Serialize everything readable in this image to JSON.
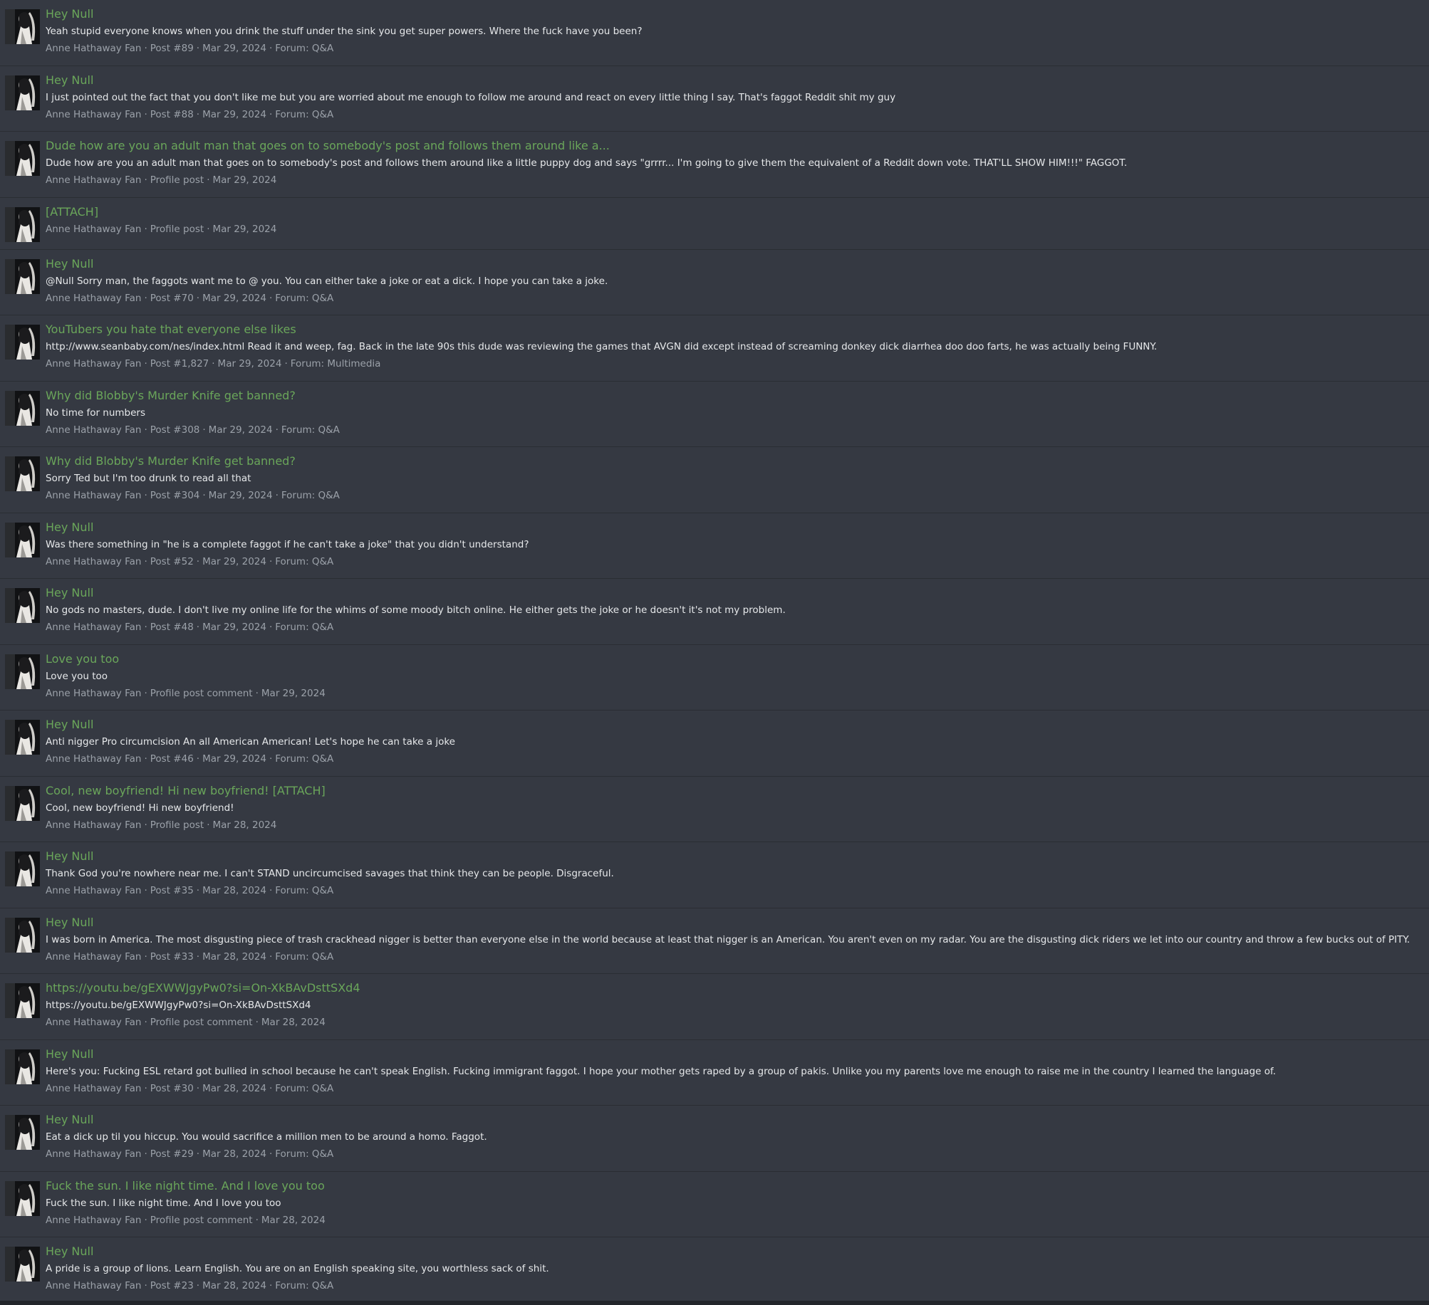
{
  "separator": "·",
  "results": [
    {
      "title": "Hey Null",
      "snippet": "Yeah stupid everyone knows when you drink the stuff under the sink you get super powers. Where the fuck have you been?",
      "user": "Anne Hathaway Fan",
      "type": "Post #89",
      "date": "Mar 29, 2024",
      "forum": "Forum: Q&A"
    },
    {
      "title": "Hey Null",
      "snippet": "I just pointed out the fact that you don't like me but you are worried about me enough to follow me around and react on every little thing I say. That's faggot Reddit shit my guy",
      "user": "Anne Hathaway Fan",
      "type": "Post #88",
      "date": "Mar 29, 2024",
      "forum": "Forum: Q&A"
    },
    {
      "title": "Dude how are you an adult man that goes on to somebody's post and follows them around like a...",
      "snippet": "Dude how are you an adult man that goes on to somebody's post and follows them around like a little puppy dog and says \"grrrr... I'm going to give them the equivalent of a Reddit down vote. THAT'LL SHOW HIM!!!\" FAGGOT.",
      "user": "Anne Hathaway Fan",
      "type": "Profile post",
      "date": "Mar 29, 2024",
      "forum": ""
    },
    {
      "title": "[ATTACH]",
      "snippet": "",
      "user": "Anne Hathaway Fan",
      "type": "Profile post",
      "date": "Mar 29, 2024",
      "forum": ""
    },
    {
      "title": "Hey Null",
      "snippet": "@Null Sorry man, the faggots want me to @ you. You can either take a joke or eat a dick. I hope you can take a joke.",
      "user": "Anne Hathaway Fan",
      "type": "Post #70",
      "date": "Mar 29, 2024",
      "forum": "Forum: Q&A"
    },
    {
      "title": "YouTubers you hate that everyone else likes",
      "snippet": "http://www.seanbaby.com/nes/index.html Read it and weep, fag. Back in the late 90s this dude was reviewing the games that AVGN did except instead of screaming donkey dick diarrhea doo doo farts, he was actually being FUNNY.",
      "user": "Anne Hathaway Fan",
      "type": "Post #1,827",
      "date": "Mar 29, 2024",
      "forum": "Forum: Multimedia"
    },
    {
      "title": "Why did Blobby's Murder Knife get banned?",
      "snippet": "No time for numbers",
      "user": "Anne Hathaway Fan",
      "type": "Post #308",
      "date": "Mar 29, 2024",
      "forum": "Forum: Q&A"
    },
    {
      "title": "Why did Blobby's Murder Knife get banned?",
      "snippet": "Sorry Ted but I'm too drunk to read all that",
      "user": "Anne Hathaway Fan",
      "type": "Post #304",
      "date": "Mar 29, 2024",
      "forum": "Forum: Q&A"
    },
    {
      "title": "Hey Null",
      "snippet": "Was there something in \"he is a complete faggot if he can't take a joke\" that you didn't understand?",
      "user": "Anne Hathaway Fan",
      "type": "Post #52",
      "date": "Mar 29, 2024",
      "forum": "Forum: Q&A"
    },
    {
      "title": "Hey Null",
      "snippet": "No gods no masters, dude. I don't live my online life for the whims of some moody bitch online. He either gets the joke or he doesn't it's not my problem.",
      "user": "Anne Hathaway Fan",
      "type": "Post #48",
      "date": "Mar 29, 2024",
      "forum": "Forum: Q&A"
    },
    {
      "title": "Love you too",
      "snippet": "Love you too",
      "user": "Anne Hathaway Fan",
      "type": "Profile post comment",
      "date": "Mar 29, 2024",
      "forum": ""
    },
    {
      "title": "Hey Null",
      "snippet": "Anti nigger Pro circumcision An all American American! Let's hope he can take a joke",
      "user": "Anne Hathaway Fan",
      "type": "Post #46",
      "date": "Mar 29, 2024",
      "forum": "Forum: Q&A"
    },
    {
      "title": "Cool, new boyfriend! Hi new boyfriend! [ATTACH]",
      "snippet": "Cool, new boyfriend! Hi new boyfriend!",
      "user": "Anne Hathaway Fan",
      "type": "Profile post",
      "date": "Mar 28, 2024",
      "forum": ""
    },
    {
      "title": "Hey Null",
      "snippet": "Thank God you're nowhere near me. I can't STAND uncircumcised savages that think they can be people. Disgraceful.",
      "user": "Anne Hathaway Fan",
      "type": "Post #35",
      "date": "Mar 28, 2024",
      "forum": "Forum: Q&A"
    },
    {
      "title": "Hey Null",
      "snippet": "I was born in America. The most disgusting piece of trash crackhead nigger is better than everyone else in the world because at least that nigger is an American. You aren't even on my radar. You are the disgusting dick riders we let into our country and throw a few bucks out of PITY.",
      "user": "Anne Hathaway Fan",
      "type": "Post #33",
      "date": "Mar 28, 2024",
      "forum": "Forum: Q&A"
    },
    {
      "title": "https://youtu.be/gEXWWJgyPw0?si=On-XkBAvDsttSXd4",
      "snippet": "https://youtu.be/gEXWWJgyPw0?si=On-XkBAvDsttSXd4",
      "user": "Anne Hathaway Fan",
      "type": "Profile post comment",
      "date": "Mar 28, 2024",
      "forum": ""
    },
    {
      "title": "Hey Null",
      "snippet": "Here's you: Fucking ESL retard got bullied in school because he can't speak English. Fucking immigrant faggot. I hope your mother gets raped by a group of pakis. Unlike you my parents love me enough to raise me in the country I learned the language of.",
      "user": "Anne Hathaway Fan",
      "type": "Post #30",
      "date": "Mar 28, 2024",
      "forum": "Forum: Q&A"
    },
    {
      "title": "Hey Null",
      "snippet": "Eat a dick up til you hiccup. You would sacrifice a million men to be around a homo. Faggot.",
      "user": "Anne Hathaway Fan",
      "type": "Post #29",
      "date": "Mar 28, 2024",
      "forum": "Forum: Q&A"
    },
    {
      "title": "Fuck the sun. I like night time. And I love you too",
      "snippet": "Fuck the sun. I like night time. And I love you too",
      "user": "Anne Hathaway Fan",
      "type": "Profile post comment",
      "date": "Mar 28, 2024",
      "forum": ""
    },
    {
      "title": "Hey Null",
      "snippet": "A pride is a group of lions. Learn English. You are on an English speaking site, you worthless sack of shit.",
      "user": "Anne Hathaway Fan",
      "type": "Post #23",
      "date": "Mar 28, 2024",
      "forum": "Forum: Q&A"
    }
  ]
}
